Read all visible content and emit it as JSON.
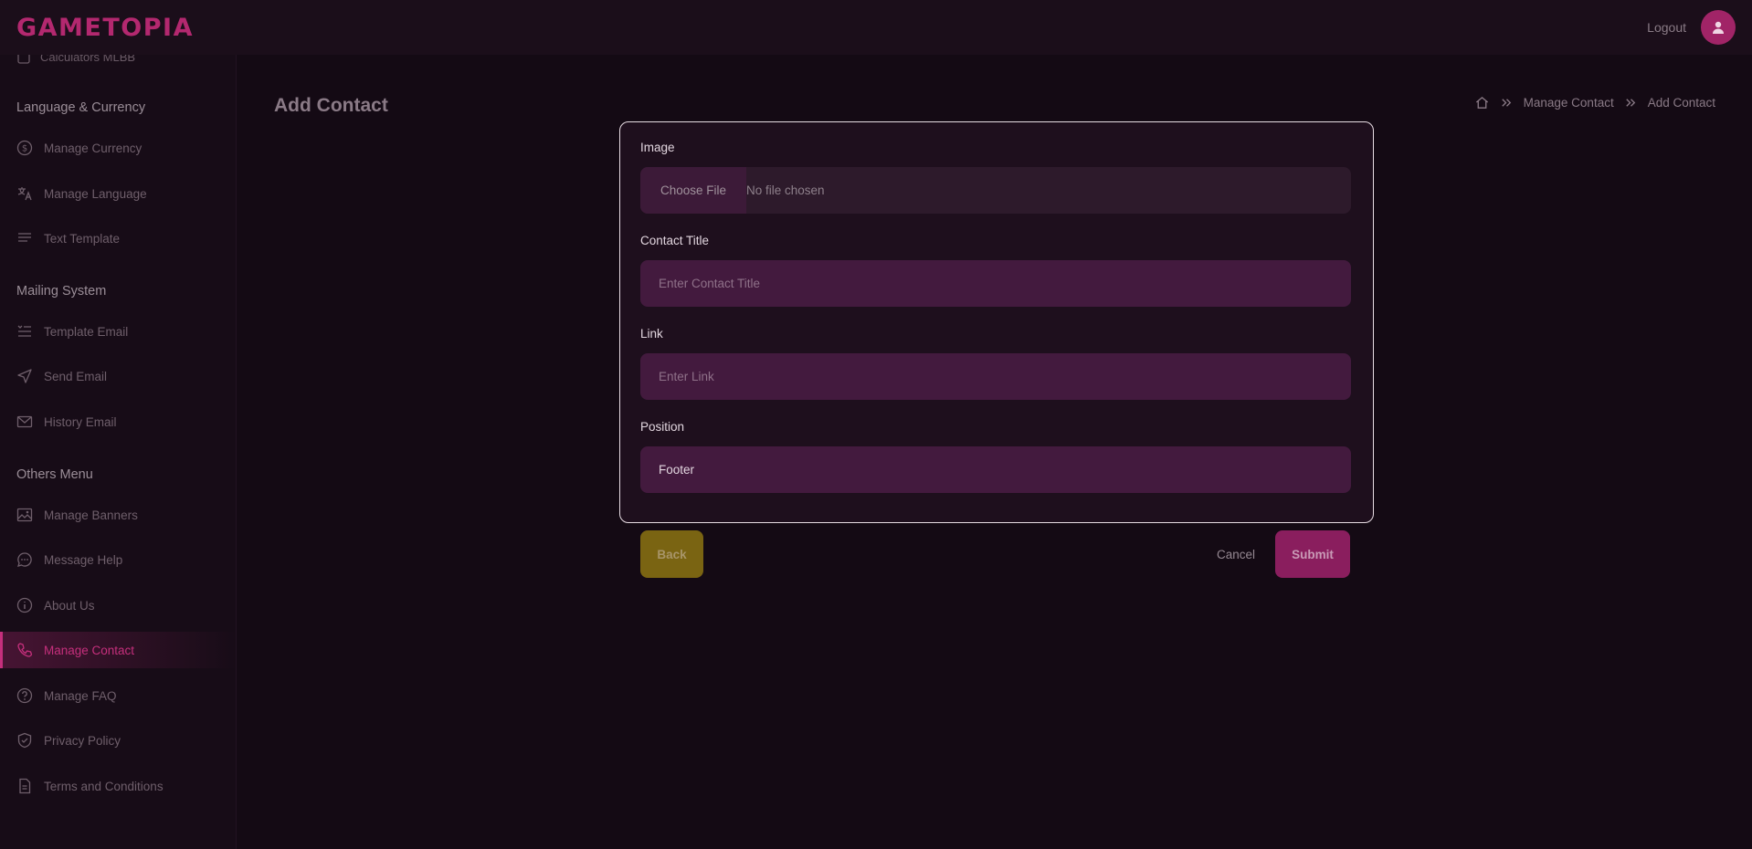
{
  "header": {
    "logo_text": "GAMETOPIA",
    "logout_label": "Logout",
    "avatar_icon": "user-icon",
    "brand_color": "#b3286f"
  },
  "sidebar": {
    "cut_item_label": "Calculators MLBB",
    "sections": [
      {
        "title": "Language & Currency",
        "items": [
          {
            "label": "Manage Currency",
            "icon": "dollar-circle-icon"
          },
          {
            "label": "Manage Language",
            "icon": "translate-icon"
          },
          {
            "label": "Text Template",
            "icon": "text-lines-icon"
          }
        ]
      },
      {
        "title": "Mailing System",
        "items": [
          {
            "label": "Template Email",
            "icon": "list-icon"
          },
          {
            "label": "Send Email",
            "icon": "send-icon"
          },
          {
            "label": "History Email",
            "icon": "mail-icon"
          }
        ]
      },
      {
        "title": "Others Menu",
        "items": [
          {
            "label": "Manage Banners",
            "icon": "image-icon"
          },
          {
            "label": "Message Help",
            "icon": "chat-icon"
          },
          {
            "label": "About Us",
            "icon": "info-icon"
          },
          {
            "label": "Manage Contact",
            "icon": "phone-icon",
            "active": true
          },
          {
            "label": "Manage FAQ",
            "icon": "question-icon"
          },
          {
            "label": "Privacy Policy",
            "icon": "shield-icon"
          },
          {
            "label": "Terms and Conditions",
            "icon": "document-icon"
          }
        ]
      }
    ]
  },
  "page": {
    "title": "Add Contact",
    "breadcrumb": [
      "Manage Contact",
      "Add Contact"
    ]
  },
  "form": {
    "image_label": "Image",
    "file_button_label": "Choose File",
    "file_status": "No file chosen",
    "contact_title_label": "Contact Title",
    "contact_title_placeholder": "Enter Contact Title",
    "contact_title_value": "",
    "link_label": "Link",
    "link_placeholder": "Enter Link",
    "link_value": "",
    "position_label": "Position",
    "position_value": "Footer"
  },
  "actions": {
    "back_label": "Back",
    "cancel_label": "Cancel",
    "submit_label": "Submit"
  }
}
